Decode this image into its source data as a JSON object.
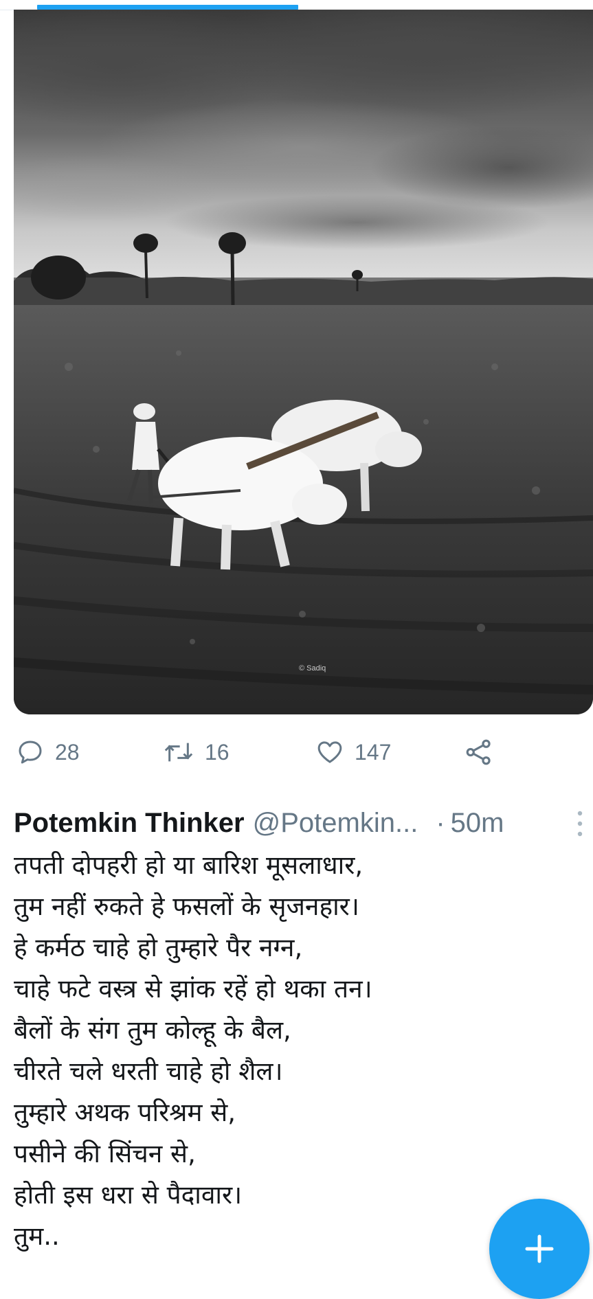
{
  "media_progress": {
    "fraction": 0.44
  },
  "media": {
    "watermark": "© Sadiq"
  },
  "actions": {
    "reply_count": "28",
    "retweet_count": "16",
    "like_count": "147",
    "icons": [
      "reply-icon",
      "retweet-icon",
      "like-icon",
      "share-icon"
    ]
  },
  "tweet": {
    "author_name": "Potemkin Thinker",
    "author_handle": "@Potemkin...",
    "separator": "·",
    "timestamp": "50m",
    "lines": [
      "तपती दोपहरी हो या बारिश मूसलाधार,",
      "तुम नहीं रुकते हे फसलों के सृजनहार।",
      "हे कर्मठ चाहे हो तुम्हारे पैर नग्न,",
      "चाहे फटे वस्त्र से झांक रहें हो थका तन।",
      "बैलों के संग तुम कोल्हू के बैल,",
      "चीरते चले धरती चाहे हो शैल।",
      "तुम्हारे अथक परिश्रम से,",
      "पसीने की सिंचन से,",
      "होती इस धरा से पैदावार।",
      "तुम.."
    ]
  },
  "fab": {
    "icon": "plus-icon"
  },
  "colors": {
    "accent": "#1da1f2",
    "muted": "#657786",
    "text": "#14171a"
  }
}
